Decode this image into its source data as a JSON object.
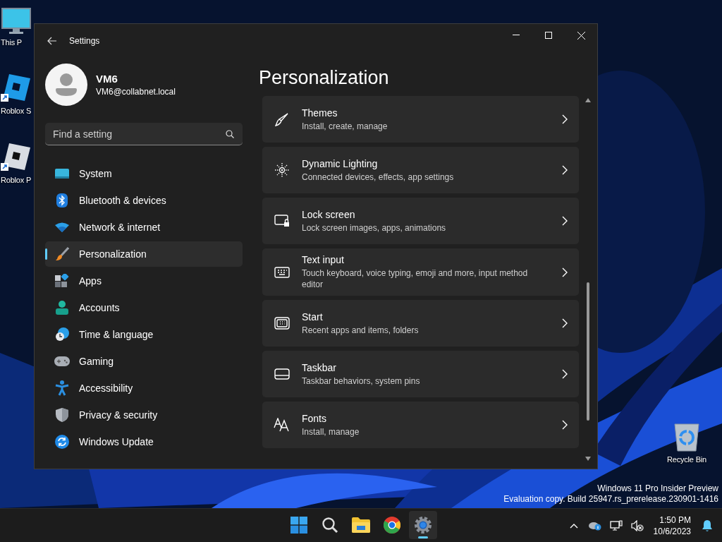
{
  "desktop": {
    "icons": [
      {
        "label": "This P"
      },
      {
        "label": "Roblox S"
      },
      {
        "label": "Roblox P"
      },
      {
        "label": "Recycle Bin"
      }
    ],
    "notice": [
      "Windows 11 Pro Insider Preview",
      "Evaluation copy. Build 25947.rs_prerelease.230901-1416"
    ]
  },
  "window": {
    "title": "Settings",
    "user": {
      "name": "VM6",
      "email": "VM6@collabnet.local"
    },
    "search": {
      "placeholder": "Find a setting"
    },
    "nav": [
      {
        "label": "System",
        "selected": false
      },
      {
        "label": "Bluetooth & devices",
        "selected": false
      },
      {
        "label": "Network & internet",
        "selected": false
      },
      {
        "label": "Personalization",
        "selected": true
      },
      {
        "label": "Apps",
        "selected": false
      },
      {
        "label": "Accounts",
        "selected": false
      },
      {
        "label": "Time & language",
        "selected": false
      },
      {
        "label": "Gaming",
        "selected": false
      },
      {
        "label": "Accessibility",
        "selected": false
      },
      {
        "label": "Privacy & security",
        "selected": false
      },
      {
        "label": "Windows Update",
        "selected": false
      }
    ],
    "page_title": "Personalization",
    "cards": [
      {
        "title": "Themes",
        "description": "Install, create, manage"
      },
      {
        "title": "Dynamic Lighting",
        "description": "Connected devices, effects, app settings"
      },
      {
        "title": "Lock screen",
        "description": "Lock screen images, apps, animations"
      },
      {
        "title": "Text input",
        "description": "Touch keyboard, voice typing, emoji and more, input method editor"
      },
      {
        "title": "Start",
        "description": "Recent apps and items, folders"
      },
      {
        "title": "Taskbar",
        "description": "Taskbar behaviors, system pins"
      },
      {
        "title": "Fonts",
        "description": "Install, manage"
      }
    ]
  },
  "taskbar": {
    "apps": [
      {
        "selected": false
      },
      {
        "selected": false
      },
      {
        "selected": false
      },
      {
        "selected": false
      },
      {
        "selected": true
      }
    ],
    "time": "1:50 PM",
    "date": "10/6/2023"
  }
}
